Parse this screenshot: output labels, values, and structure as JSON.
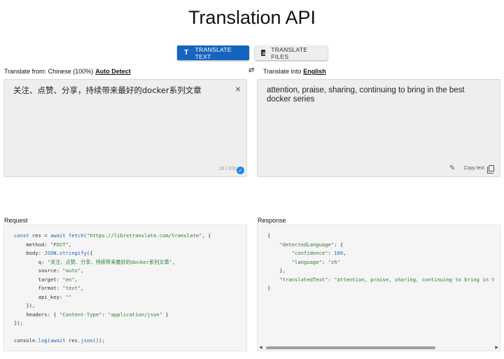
{
  "page": {
    "title": "Translation API"
  },
  "modes": {
    "translate_text": "Translate Text",
    "translate_files": "Translate Files"
  },
  "source": {
    "prefix": "Translate from: Chinese (100%)",
    "detect_link": "Auto Detect",
    "text": "关注、点赞、分享，持续带来最好的docker系列文章",
    "counter": "26 / 200"
  },
  "target": {
    "prefix": "Translate into",
    "language_link": "English",
    "text": "attention, praise, sharing, continuing to bring in the best docker series",
    "copy_label": "Copy text"
  },
  "request": {
    "label": "Request",
    "url": "\"https://libretranslate.com/translate\"",
    "method_value": "\"POST\"",
    "q_value": "\"关注、点赞、分享，持续带来最好的docker系列文章\"",
    "source_value": "\"auto\"",
    "target_value": "\"en\"",
    "format_value": "\"text\"",
    "api_key_value": "\"\"",
    "content_type_key": "\"Content-Type\"",
    "content_type_value": "\"application/json\""
  },
  "response": {
    "label": "Response",
    "detected_key": "\"detectedLanguage\"",
    "confidence_key": "\"confidence\"",
    "confidence_value": "100",
    "language_key": "\"language\"",
    "language_value": "\"zh\"",
    "translated_key": "\"translatedText\"",
    "translated_value": "\"attention, praise, sharing, continuing to bring in t"
  },
  "icons": {
    "text_mode": "T",
    "swap": "⇄",
    "clear": "×",
    "check": "✓",
    "pencil": "✎",
    "scroll_left": "◀",
    "scroll_right": "▶"
  },
  "colors": {
    "accent": "#1565c0",
    "string": "#2e7d32"
  }
}
